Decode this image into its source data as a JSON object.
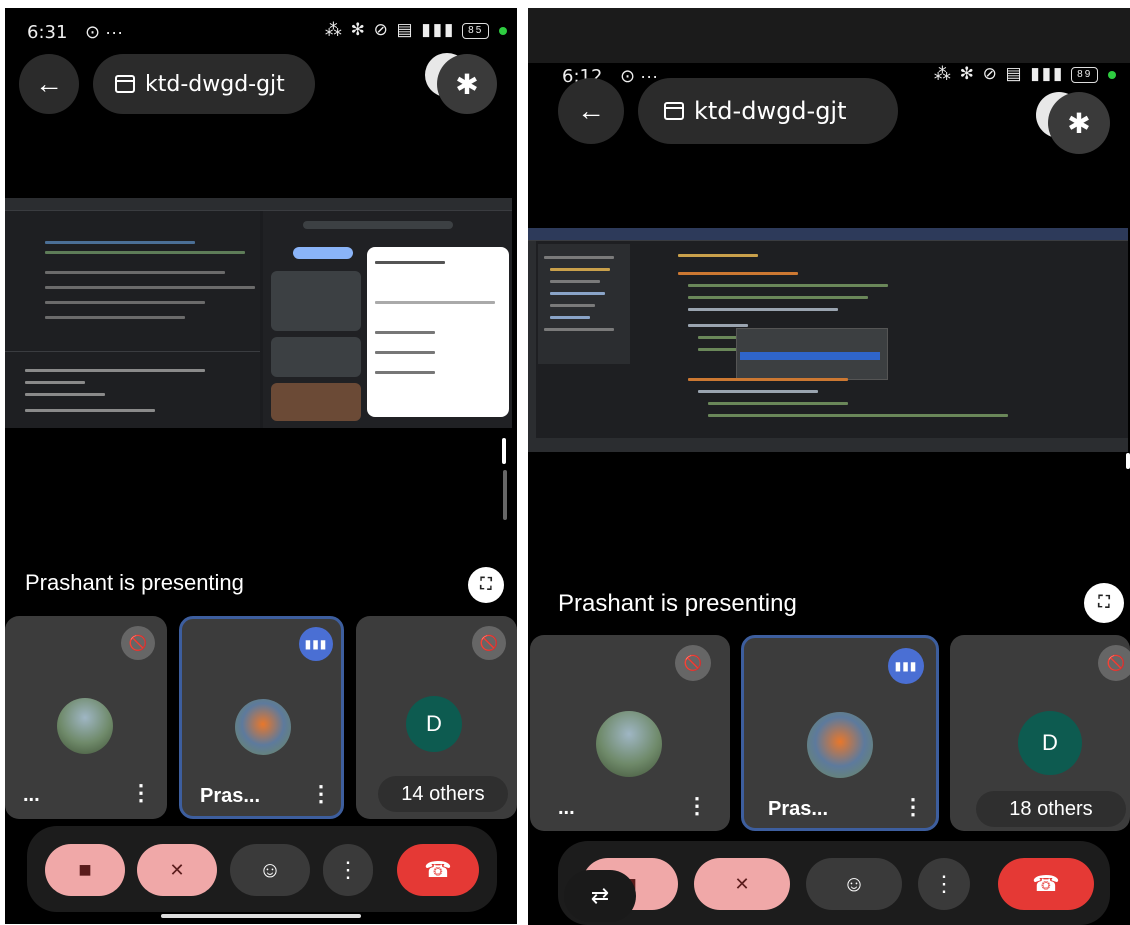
{
  "left": {
    "status": {
      "time": "6:31",
      "icons": "⊙ ···",
      "right_icons": "⁂ ✻ ⊘ ▤ ▮▮▮",
      "battery": "85"
    },
    "meeting_code": "ktd-dwgd-gjt",
    "presenting_label": "Prashant is presenting",
    "tiles": [
      {
        "name": "...",
        "muted": true
      },
      {
        "name": "Pras...",
        "speaking": true
      },
      {
        "avatar_letter": "D",
        "others_label": "14 others",
        "muted": true
      }
    ]
  },
  "right": {
    "status": {
      "time": "6:12",
      "icons": "⊙ ···",
      "right_icons": "⁂ ✻ ⊘ ▤ ▮▮▮",
      "battery": "89"
    },
    "meeting_code": "ktd-dwgd-gjt",
    "presenting_label": "Prashant is presenting",
    "tiles": [
      {
        "name": "...",
        "muted": true
      },
      {
        "name": "Pras...",
        "speaking": true
      },
      {
        "avatar_letter": "D",
        "others_label": "18 others",
        "muted": true
      }
    ]
  },
  "icons": {
    "back": "←",
    "bluetooth": "✱",
    "fullscreen": "⛶",
    "mic_off": "🎙",
    "camera_off": "■",
    "emoji": "☺",
    "more": "⋮",
    "hangup": "☎",
    "switch_camera": "⇄",
    "speaking": "▮▮▮"
  },
  "colors": {
    "hangup": "#e53935",
    "muted_button": "#f0a8a8",
    "active_tile_border": "#3d5e9e",
    "avatar_d": "#0d5b50"
  }
}
